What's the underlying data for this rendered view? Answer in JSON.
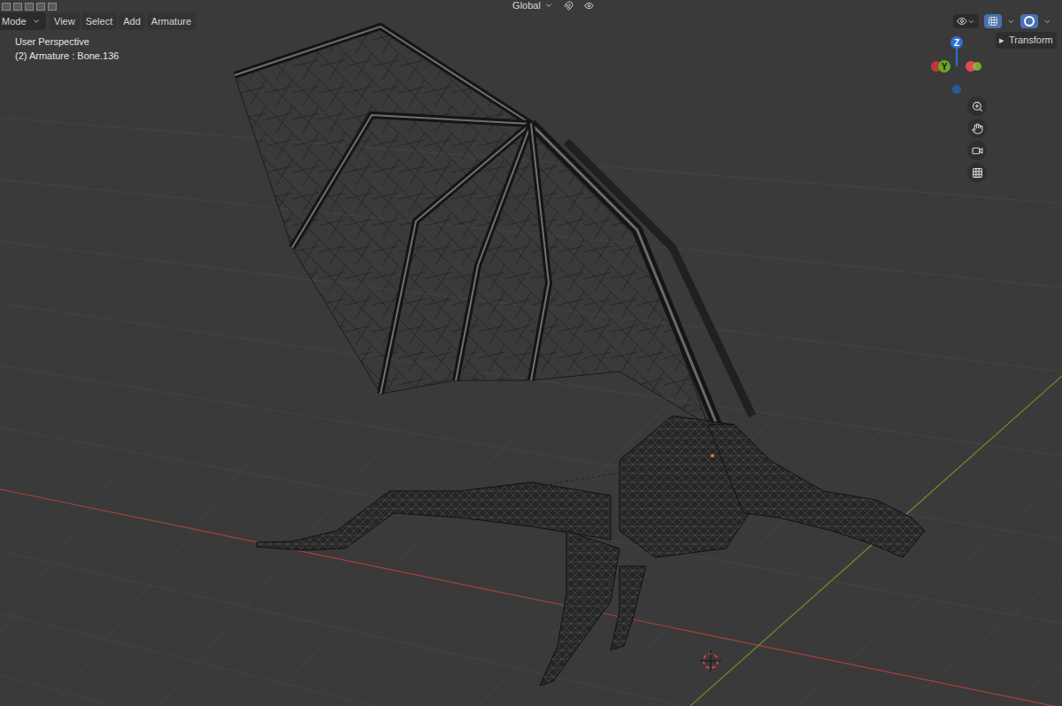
{
  "header": {
    "mode": "Mode",
    "menus": [
      "View",
      "Select",
      "Add",
      "Armature"
    ],
    "orientation": "Global"
  },
  "viewport": {
    "overlay_lines": [
      "User Perspective",
      "(2) Armature : Bone.136"
    ]
  },
  "gizmo": {
    "axes": [
      {
        "label": "Z",
        "color": "#2f6fd6"
      },
      {
        "label": "Y",
        "color": "#6aa826"
      }
    ]
  },
  "sidebar": {
    "tabs": [
      {
        "arrow": "▸",
        "label": "Transform",
        "expanded": false
      }
    ]
  }
}
